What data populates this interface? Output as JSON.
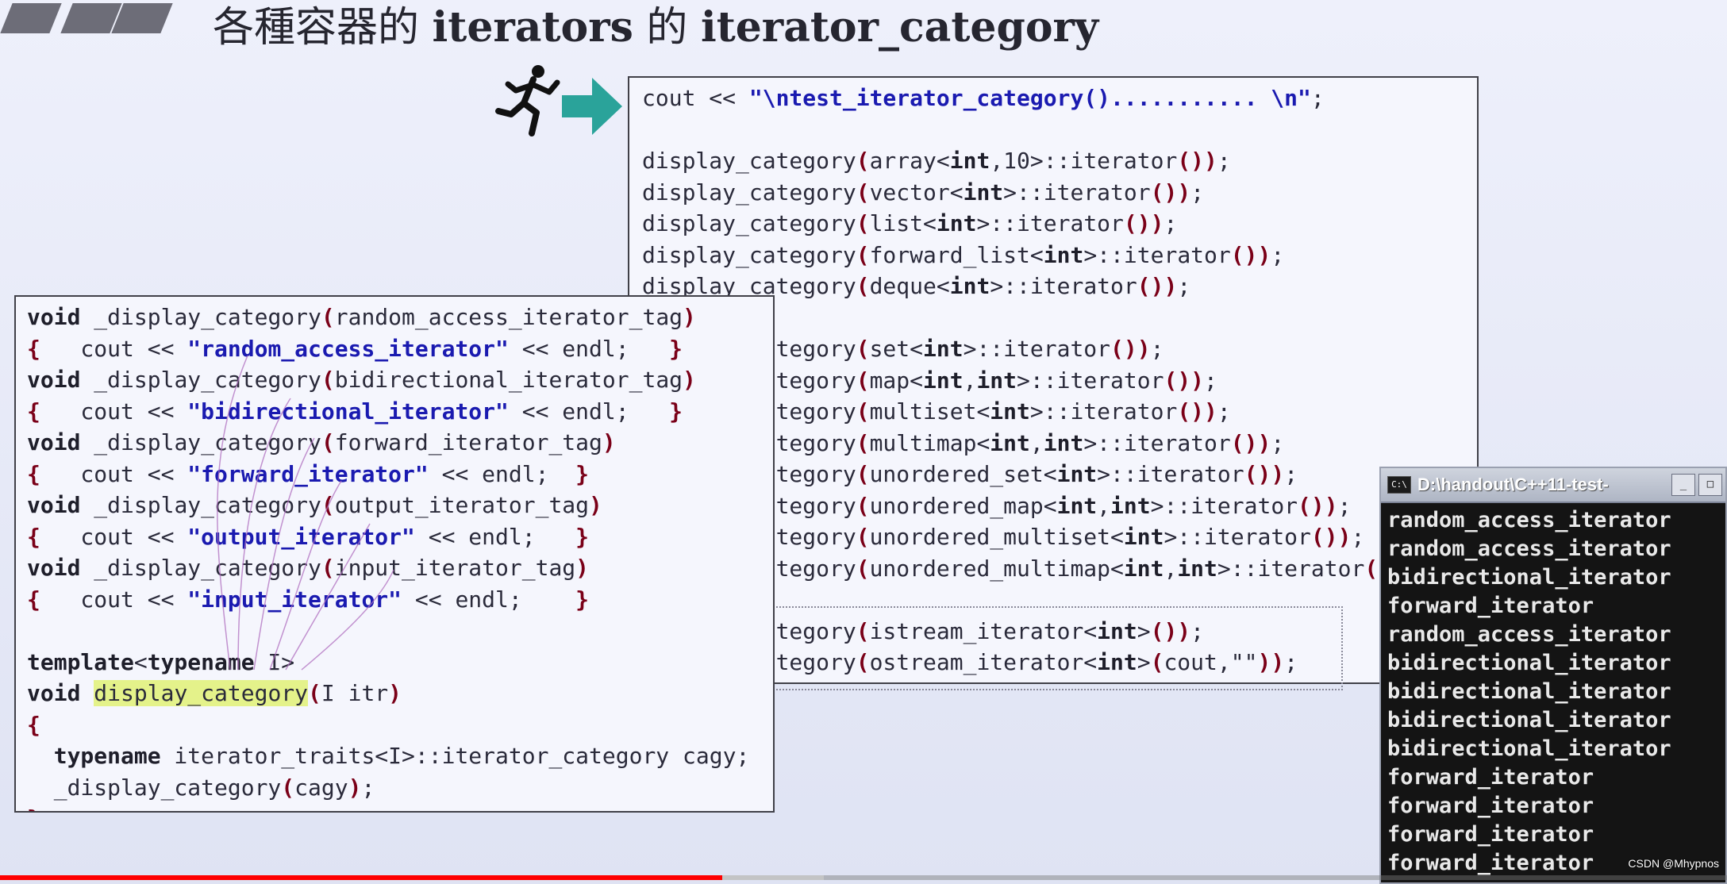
{
  "slide": {
    "title_cjk_1": "各種容器的",
    "title_word_1": "iterators",
    "title_cjk_2": "的",
    "title_word_2": "iterator_category"
  },
  "test_code": [
    [
      {
        "t": "cout << "
      },
      {
        "t": "\"\\ntest_iterator_category()........... \\n\"",
        "s": "str"
      },
      {
        "t": ";"
      }
    ],
    [],
    [
      {
        "t": "display_category"
      },
      {
        "t": "(",
        "s": "paren"
      },
      {
        "t": "array<"
      },
      {
        "t": "int",
        "s": "kw"
      },
      {
        "t": ",10>::iterator"
      },
      {
        "t": "())",
        "s": "paren"
      },
      {
        "t": ";"
      }
    ],
    [
      {
        "t": "display_category"
      },
      {
        "t": "(",
        "s": "paren"
      },
      {
        "t": "vector<"
      },
      {
        "t": "int",
        "s": "kw"
      },
      {
        "t": ">::iterator"
      },
      {
        "t": "())",
        "s": "paren"
      },
      {
        "t": ";"
      }
    ],
    [
      {
        "t": "display_category"
      },
      {
        "t": "(",
        "s": "paren"
      },
      {
        "t": "list<"
      },
      {
        "t": "int",
        "s": "kw"
      },
      {
        "t": ">::iterator"
      },
      {
        "t": "())",
        "s": "paren"
      },
      {
        "t": ";"
      }
    ],
    [
      {
        "t": "display_category"
      },
      {
        "t": "(",
        "s": "paren"
      },
      {
        "t": "forward_list<"
      },
      {
        "t": "int",
        "s": "kw"
      },
      {
        "t": ">::iterator"
      },
      {
        "t": "())",
        "s": "paren"
      },
      {
        "t": ";"
      }
    ],
    [
      {
        "t": "display_category"
      },
      {
        "t": "(",
        "s": "paren"
      },
      {
        "t": "deque<"
      },
      {
        "t": "int",
        "s": "kw"
      },
      {
        "t": ">::iterator"
      },
      {
        "t": "())",
        "s": "paren"
      },
      {
        "t": ";"
      }
    ],
    [],
    [
      {
        "t": "display_category"
      },
      {
        "t": "(",
        "s": "paren"
      },
      {
        "t": "set<"
      },
      {
        "t": "int",
        "s": "kw"
      },
      {
        "t": ">::iterator"
      },
      {
        "t": "())",
        "s": "paren"
      },
      {
        "t": ";"
      }
    ],
    [
      {
        "t": "display_category"
      },
      {
        "t": "(",
        "s": "paren"
      },
      {
        "t": "map<"
      },
      {
        "t": "int",
        "s": "kw"
      },
      {
        "t": ","
      },
      {
        "t": "int",
        "s": "kw"
      },
      {
        "t": ">::iterator"
      },
      {
        "t": "())",
        "s": "paren"
      },
      {
        "t": ";"
      }
    ],
    [
      {
        "t": "display_category"
      },
      {
        "t": "(",
        "s": "paren"
      },
      {
        "t": "multiset<"
      },
      {
        "t": "int",
        "s": "kw"
      },
      {
        "t": ">::iterator"
      },
      {
        "t": "())",
        "s": "paren"
      },
      {
        "t": ";"
      }
    ],
    [
      {
        "t": "display_category"
      },
      {
        "t": "(",
        "s": "paren"
      },
      {
        "t": "multimap<"
      },
      {
        "t": "int",
        "s": "kw"
      },
      {
        "t": ","
      },
      {
        "t": "int",
        "s": "kw"
      },
      {
        "t": ">::iterator"
      },
      {
        "t": "())",
        "s": "paren"
      },
      {
        "t": ";"
      }
    ],
    [
      {
        "t": "display_category"
      },
      {
        "t": "(",
        "s": "paren"
      },
      {
        "t": "unordered_set<"
      },
      {
        "t": "int",
        "s": "kw"
      },
      {
        "t": ">::iterator"
      },
      {
        "t": "())",
        "s": "paren"
      },
      {
        "t": ";"
      }
    ],
    [
      {
        "t": "display_category"
      },
      {
        "t": "(",
        "s": "paren"
      },
      {
        "t": "unordered_map<"
      },
      {
        "t": "int",
        "s": "kw"
      },
      {
        "t": ","
      },
      {
        "t": "int",
        "s": "kw"
      },
      {
        "t": ">::iterator"
      },
      {
        "t": "())",
        "s": "paren"
      },
      {
        "t": ";"
      }
    ],
    [
      {
        "t": "display_category"
      },
      {
        "t": "(",
        "s": "paren"
      },
      {
        "t": "unordered_multiset<"
      },
      {
        "t": "int",
        "s": "kw"
      },
      {
        "t": ">::iterator"
      },
      {
        "t": "())",
        "s": "paren"
      },
      {
        "t": ";"
      }
    ],
    [
      {
        "t": "display_category"
      },
      {
        "t": "(",
        "s": "paren"
      },
      {
        "t": "unordered_multimap<"
      },
      {
        "t": "int",
        "s": "kw"
      },
      {
        "t": ","
      },
      {
        "t": "int",
        "s": "kw"
      },
      {
        "t": ">::iterator"
      },
      {
        "t": "())",
        "s": "paren"
      },
      {
        "t": ";"
      }
    ],
    [],
    [
      {
        "t": "display_category"
      },
      {
        "t": "(",
        "s": "paren"
      },
      {
        "t": "istream_iterator<"
      },
      {
        "t": "int",
        "s": "kw"
      },
      {
        "t": ">"
      },
      {
        "t": "())",
        "s": "paren"
      },
      {
        "t": ";"
      }
    ],
    [
      {
        "t": "display_category"
      },
      {
        "t": "(",
        "s": "paren"
      },
      {
        "t": "ostream_iterator<"
      },
      {
        "t": "int",
        "s": "kw"
      },
      {
        "t": ">"
      },
      {
        "t": "(",
        "s": "paren"
      },
      {
        "t": "cout,\"\""
      },
      {
        "t": "))",
        "s": "paren"
      },
      {
        "t": ";"
      }
    ]
  ],
  "impl_code": [
    [
      {
        "t": "void",
        "s": "kw"
      },
      {
        "t": " _display_category"
      },
      {
        "t": "(",
        "s": "paren"
      },
      {
        "t": "random_access_iterator_tag"
      },
      {
        "t": ")",
        "s": "paren"
      }
    ],
    [
      {
        "t": "{",
        "s": "paren"
      },
      {
        "t": "   cout << "
      },
      {
        "t": "\"random_access_iterator\"",
        "s": "str"
      },
      {
        "t": " << endl;   "
      },
      {
        "t": "}",
        "s": "paren"
      }
    ],
    [
      {
        "t": "void",
        "s": "kw"
      },
      {
        "t": " _display_category"
      },
      {
        "t": "(",
        "s": "paren"
      },
      {
        "t": "bidirectional_iterator_tag"
      },
      {
        "t": ")",
        "s": "paren"
      }
    ],
    [
      {
        "t": "{",
        "s": "paren"
      },
      {
        "t": "   cout << "
      },
      {
        "t": "\"bidirectional_iterator\"",
        "s": "str"
      },
      {
        "t": " << endl;   "
      },
      {
        "t": "}",
        "s": "paren"
      }
    ],
    [
      {
        "t": "void",
        "s": "kw"
      },
      {
        "t": " _display_category"
      },
      {
        "t": "(",
        "s": "paren"
      },
      {
        "t": "forward_iterator_tag"
      },
      {
        "t": ")",
        "s": "paren"
      }
    ],
    [
      {
        "t": "{",
        "s": "paren"
      },
      {
        "t": "   cout << "
      },
      {
        "t": "\"forward_iterator\"",
        "s": "str"
      },
      {
        "t": " << endl;  "
      },
      {
        "t": "}",
        "s": "paren"
      }
    ],
    [
      {
        "t": "void",
        "s": "kw"
      },
      {
        "t": " _display_category"
      },
      {
        "t": "(",
        "s": "paren"
      },
      {
        "t": "output_iterator_tag"
      },
      {
        "t": ")",
        "s": "paren"
      }
    ],
    [
      {
        "t": "{",
        "s": "paren"
      },
      {
        "t": "   cout << "
      },
      {
        "t": "\"output_iterator\"",
        "s": "str"
      },
      {
        "t": " << endl;   "
      },
      {
        "t": "}",
        "s": "paren"
      }
    ],
    [
      {
        "t": "void",
        "s": "kw"
      },
      {
        "t": " _display_category"
      },
      {
        "t": "(",
        "s": "paren"
      },
      {
        "t": "input_iterator_tag"
      },
      {
        "t": ")",
        "s": "paren"
      }
    ],
    [
      {
        "t": "{",
        "s": "paren"
      },
      {
        "t": "   cout << "
      },
      {
        "t": "\"input_iterator\"",
        "s": "str"
      },
      {
        "t": " << endl;    "
      },
      {
        "t": "}",
        "s": "paren"
      }
    ],
    [],
    [
      {
        "t": "template",
        "s": "kw"
      },
      {
        "t": "<"
      },
      {
        "t": "typename",
        "s": "kw"
      },
      {
        "t": " I>"
      }
    ],
    [
      {
        "t": "void",
        "s": "kw"
      },
      {
        "t": " "
      },
      {
        "t": "display_category",
        "s": "hl"
      },
      {
        "t": "(",
        "s": "paren"
      },
      {
        "t": "I itr"
      },
      {
        "t": ")",
        "s": "paren"
      }
    ],
    [
      {
        "t": "{",
        "s": "paren"
      }
    ],
    [
      {
        "t": "  "
      },
      {
        "t": "typename",
        "s": "kw"
      },
      {
        "t": " iterator_traits<I>::iterator_category cagy;"
      }
    ],
    [
      {
        "t": "  _display_category"
      },
      {
        "t": "(",
        "s": "paren"
      },
      {
        "t": "cagy"
      },
      {
        "t": ")",
        "s": "paren"
      },
      {
        "t": ";"
      }
    ],
    [
      {
        "t": "}",
        "s": "paren"
      }
    ]
  ],
  "console": {
    "title": "D:\\handout\\C++11-test-",
    "icon_label": "C:\\",
    "lines": [
      "random_access_iterator",
      "random_access_iterator",
      "bidirectional_iterator",
      "forward_iterator",
      "random_access_iterator",
      "bidirectional_iterator",
      "bidirectional_iterator",
      "bidirectional_iterator",
      "bidirectional_iterator",
      "forward_iterator",
      "forward_iterator",
      "forward_iterator",
      "forward_iterator"
    ]
  },
  "video": {
    "played_fraction": 0.418,
    "buffered_fraction": 0.477,
    "accent": "#ff0000"
  },
  "watermark": "CSDN @Mhypnos"
}
